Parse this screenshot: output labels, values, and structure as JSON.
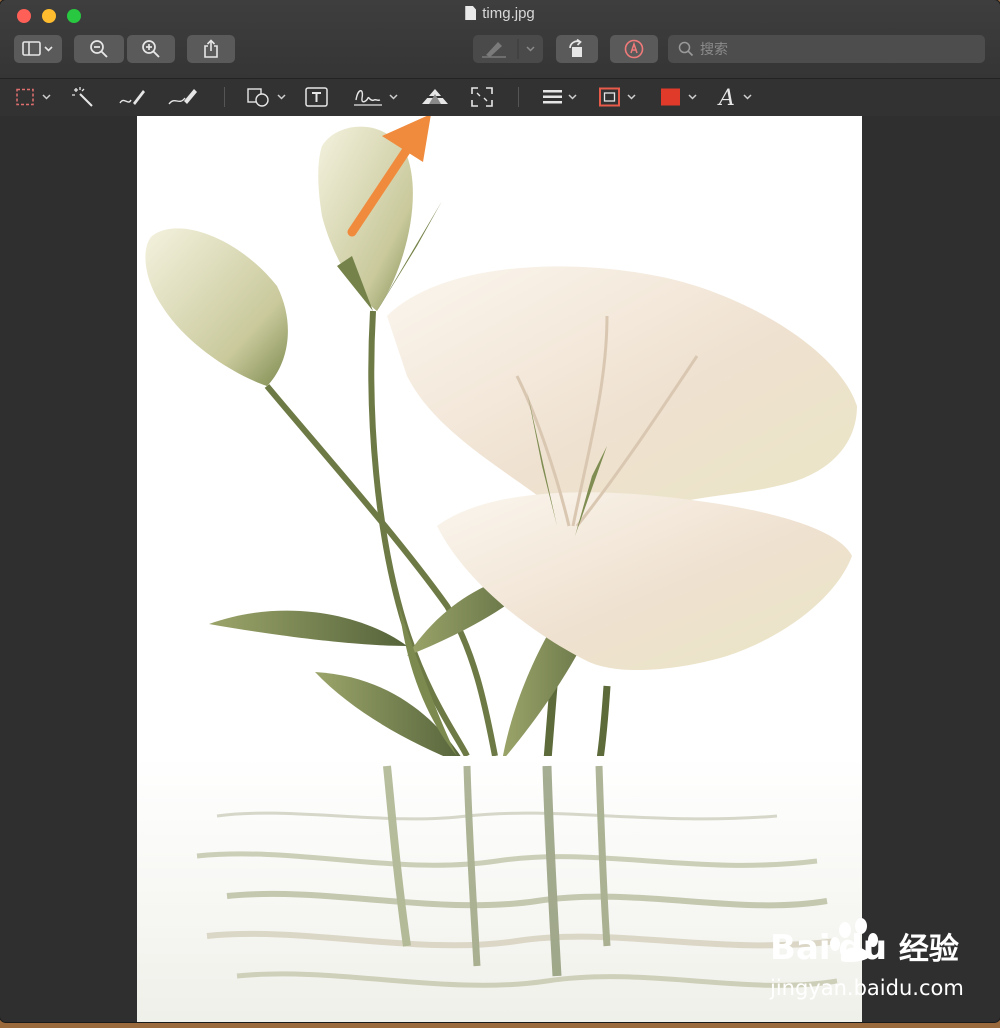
{
  "window": {
    "title": "timg.jpg"
  },
  "toolbar": {
    "search_placeholder": "搜索",
    "buttons": [
      "sidebar-view-menu",
      "zoom-out",
      "zoom-in",
      "share",
      "highlight-pen",
      "rotate-left",
      "markup-toggle"
    ]
  },
  "markup_toolbar": {
    "tools": [
      "rectangular-selection",
      "instant-alpha",
      "sketch",
      "draw",
      "shapes",
      "text",
      "sign",
      "adjust-color",
      "adjust-size",
      "shape-style",
      "border-color",
      "fill-color",
      "text-style"
    ],
    "fill_color": "#e03a2a",
    "border_color": "#e85a4a"
  },
  "annotation": {
    "arrow_color": "#f08a3c"
  },
  "watermark": {
    "brand_latin": "Bai",
    "brand_latin_2": "du",
    "brand_cn": "经验",
    "url": "jingyan.baidu.com"
  }
}
